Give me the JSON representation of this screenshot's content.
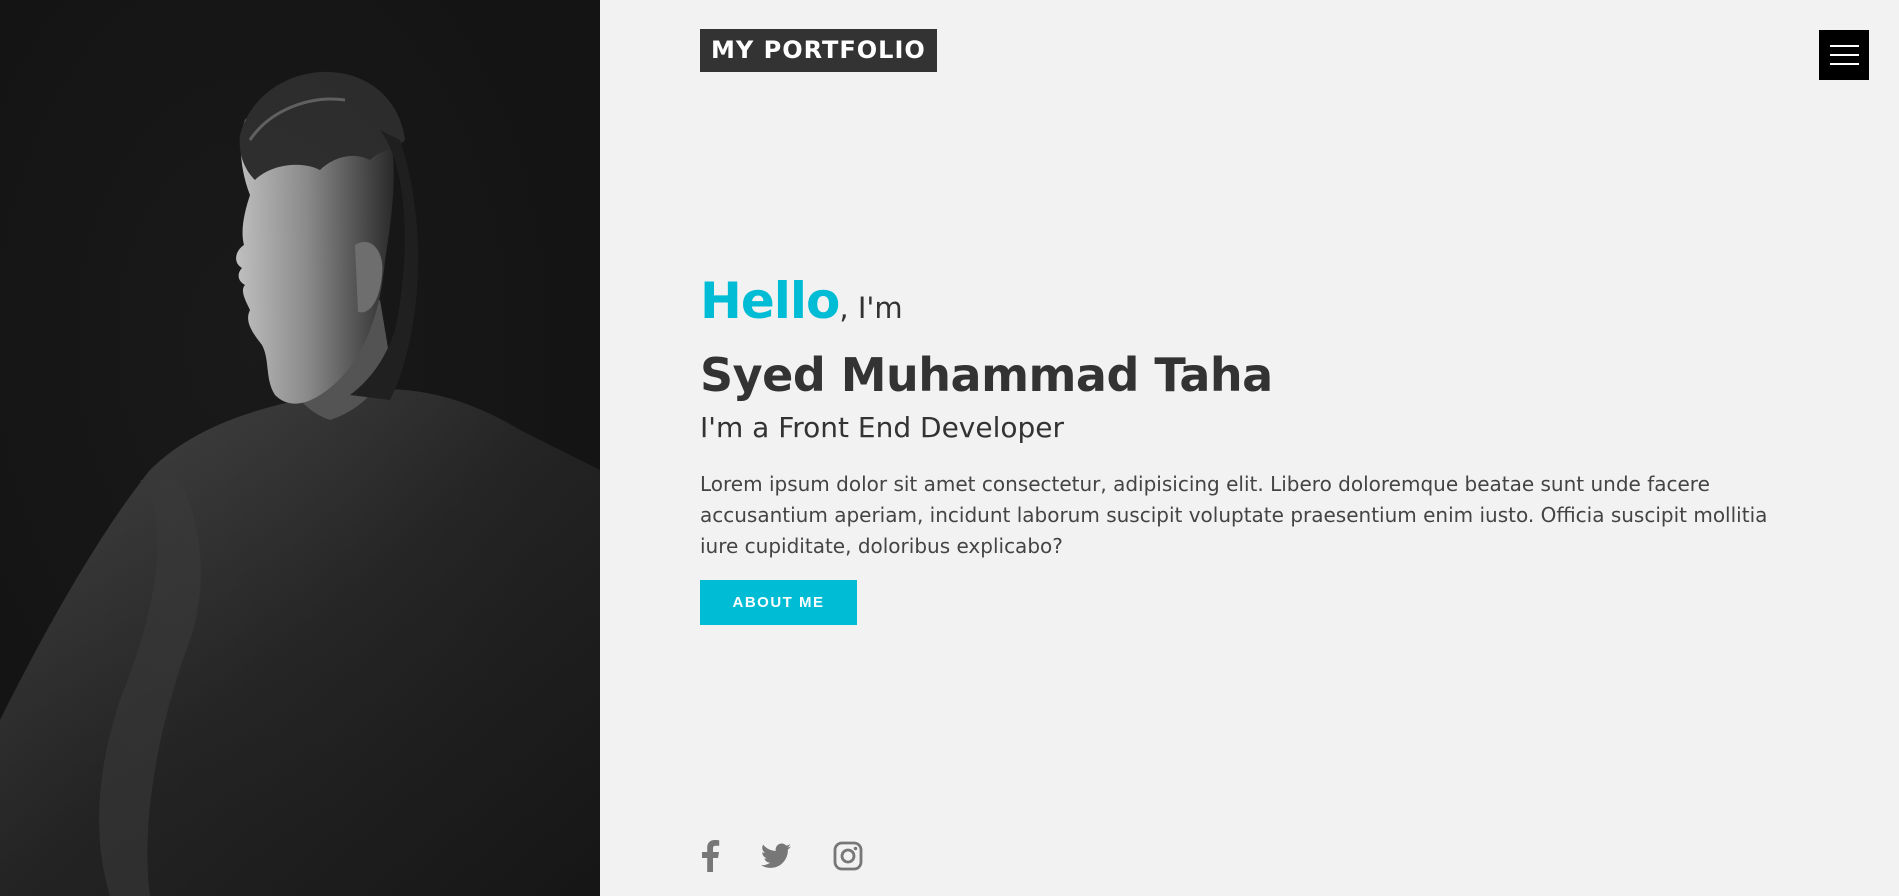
{
  "header": {
    "logo_text": "MY PORTFOLIO",
    "menu_icon": "hamburger-menu-icon"
  },
  "hero": {
    "hello": "Hello",
    "greeting_suffix": ", I'm",
    "name": "Syed Muhammad Taha",
    "role": "I'm a Front End Developer",
    "bio": "Lorem ipsum dolor sit amet consectetur, adipisicing elit. Libero doloremque beatae sunt unde facere accusantium aperiam, incidunt laborum suscipit voluptate praesentium enim iusto. Officia suscipit mollitia iure cupiditate, doloribus explicabo?",
    "cta_label": "ABOUT ME"
  },
  "socials": [
    {
      "icon": "facebook-icon"
    },
    {
      "icon": "twitter-icon"
    },
    {
      "icon": "instagram-icon"
    }
  ],
  "colors": {
    "accent": "#00bcd4",
    "text": "#333333",
    "background": "#f2f2f2",
    "photo_panel": "#141414"
  }
}
